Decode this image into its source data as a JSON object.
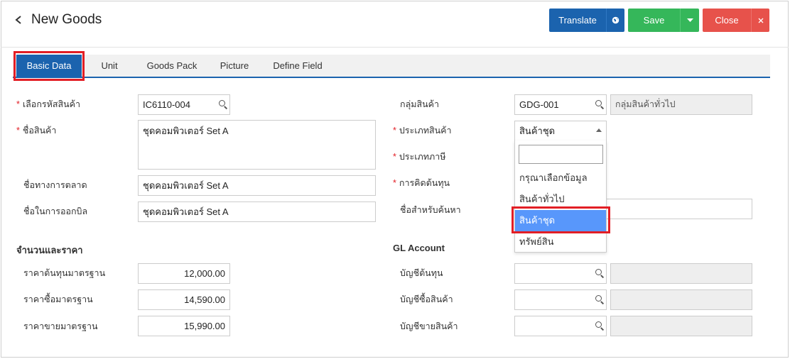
{
  "header": {
    "title": "New Goods",
    "translate_label": "Translate",
    "save_label": "Save",
    "close_label": "Close",
    "colors": {
      "primary": "#1b63ae",
      "save": "#35b75a",
      "close": "#e7524b",
      "highlight": "#e21e25"
    }
  },
  "tabs": [
    {
      "label": "Basic Data",
      "active": true
    },
    {
      "label": "Unit"
    },
    {
      "label": "Goods Pack"
    },
    {
      "label": "Picture"
    },
    {
      "label": "Define Field"
    }
  ],
  "left": {
    "goods_code": {
      "label": "เลือกรหัสสินค้า",
      "value": "IC6110-004"
    },
    "goods_name": {
      "label": "ชื่อสินค้า",
      "value": "ชุดคอมพิวเตอร์ Set A"
    },
    "marketing_name": {
      "label": "ชื่อทางการตลาด",
      "value": "ชุดคอมพิวเตอร์ Set A"
    },
    "billing_name": {
      "label": "ชื่อในการออกบิล",
      "value": "ชุดคอมพิวเตอร์ Set A"
    },
    "qty_price_title": "จำนวนและราคา",
    "std_cost": {
      "label": "ราคาต้นทุนมาตรฐาน",
      "value": "12,000.00"
    },
    "std_buy": {
      "label": "ราคาซื้อมาตรฐาน",
      "value": "14,590.00"
    },
    "std_sell": {
      "label": "ราคาขายมาตรฐาน",
      "value": "15,990.00"
    }
  },
  "right": {
    "goods_group": {
      "label": "กลุ่มสินค้า",
      "value": "GDG-001",
      "name": "กลุ่มสินค้าทั่วไป"
    },
    "goods_type": {
      "label": "ประเภทสินค้า",
      "value": "สินค้าชุด"
    },
    "tax_type": {
      "label": "ประเภทภาษี"
    },
    "costing": {
      "label": "การคิดต้นทุน"
    },
    "search_name": {
      "label": "ชื่อสำหรับค้นหา",
      "value": ""
    },
    "gl_title": "GL Account",
    "cost_account": {
      "label": "บัญชีต้นทุน",
      "value": ""
    },
    "purchase_account": {
      "label": "บัญชีซื้อสินค้า",
      "value": ""
    },
    "sales_account": {
      "label": "บัญชีขายสินค้า",
      "value": ""
    }
  },
  "dropdown": {
    "search_value": "",
    "options": [
      "กรุณาเลือกข้อมูล",
      "สินค้าทั่วไป",
      "สินค้าชุด",
      "ทรัพย์สิน"
    ],
    "selected_index": 2
  },
  "icons": {
    "back": "chevron-left-icon",
    "translate": "globe-icon",
    "save_menu": "caret-down-icon",
    "close": "close-icon",
    "search": "search-icon"
  }
}
